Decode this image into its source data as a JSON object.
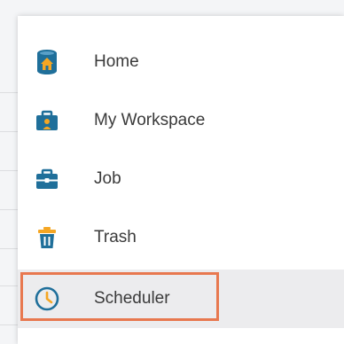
{
  "menu": {
    "items": [
      {
        "label": "Home",
        "icon": "home-database-icon"
      },
      {
        "label": "My Workspace",
        "icon": "workspace-briefcase-icon"
      },
      {
        "label": "Job",
        "icon": "job-briefcase-icon"
      },
      {
        "label": "Trash",
        "icon": "trash-icon"
      },
      {
        "label": "Scheduler",
        "icon": "clock-icon"
      }
    ],
    "active_item": "Scheduler"
  },
  "colors": {
    "icon_primary": "#1f6f9a",
    "icon_accent": "#f5a623",
    "highlight_border": "#e8784f",
    "active_background": "#ececee"
  }
}
